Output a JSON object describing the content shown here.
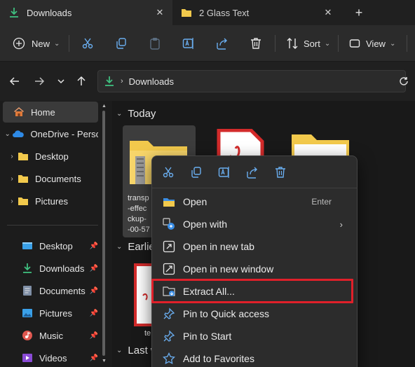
{
  "tabs": [
    {
      "label": "Downloads",
      "active": true
    },
    {
      "label": "2 Glass Text",
      "active": false
    }
  ],
  "toolbar": {
    "new_label": "New",
    "sort_label": "Sort",
    "view_label": "View"
  },
  "address": {
    "path": "Downloads"
  },
  "sidebar": {
    "items": [
      {
        "label": "Home",
        "icon": "home-icon",
        "selected": true
      },
      {
        "label": "OneDrive - Perso",
        "icon": "onedrive-icon"
      },
      {
        "label": "Desktop",
        "icon": "folder-icon"
      },
      {
        "label": "Documents",
        "icon": "folder-icon"
      },
      {
        "label": "Pictures",
        "icon": "folder-icon"
      },
      {
        "label": "Desktop",
        "icon": "desktop-icon",
        "pinned": true
      },
      {
        "label": "Downloads",
        "icon": "download-icon",
        "pinned": true
      },
      {
        "label": "Documents",
        "icon": "documents-icon",
        "pinned": true
      },
      {
        "label": "Pictures",
        "icon": "pictures-icon",
        "pinned": true
      },
      {
        "label": "Music",
        "icon": "music-icon",
        "pinned": true
      },
      {
        "label": "Videos",
        "icon": "videos-icon",
        "pinned": true
      }
    ]
  },
  "content": {
    "groups": [
      "Today",
      "Earlie",
      "Last w"
    ],
    "zip_file_lines": [
      "transp",
      "-effec",
      "ckup-",
      "-00-57"
    ],
    "second_file_label": "te"
  },
  "context_menu": {
    "items": [
      {
        "label": "Open",
        "shortcut": "Enter",
        "icon": "folder-open-icon"
      },
      {
        "label": "Open with",
        "submenu": true,
        "icon": "open-with-icon"
      },
      {
        "label": "Open in new tab",
        "icon": "new-tab-icon"
      },
      {
        "label": "Open in new window",
        "icon": "new-window-icon"
      },
      {
        "label": "Extract All...",
        "icon": "extract-icon",
        "highlighted": true
      },
      {
        "label": "Pin to Quick access",
        "icon": "pin-icon"
      },
      {
        "label": "Pin to Start",
        "icon": "pin-start-icon"
      },
      {
        "label": "Add to Favorites",
        "icon": "star-icon"
      }
    ]
  },
  "colors": {
    "accent_green": "#3fbf7f",
    "folder_yellow": "#f2c94c",
    "highlight_red": "#e0202a"
  }
}
